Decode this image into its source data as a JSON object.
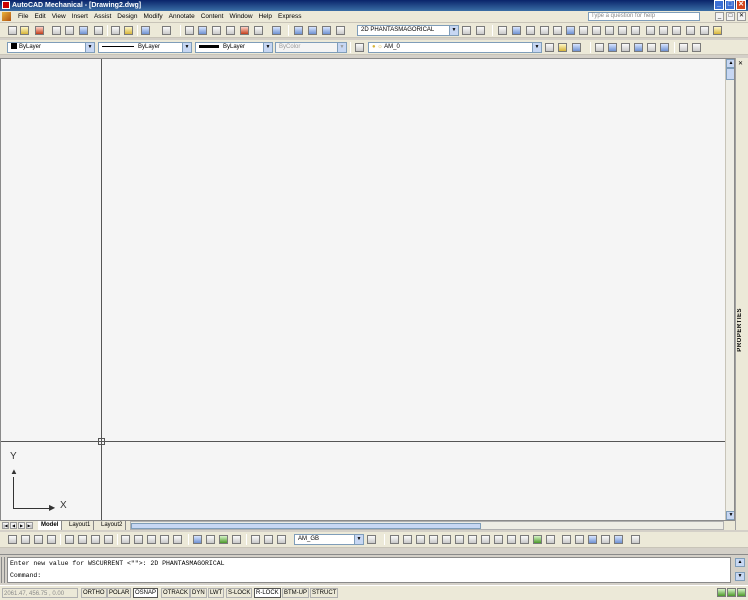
{
  "title": "AutoCAD Mechanical - [Drawing2.dwg]",
  "menu": [
    "File",
    "Edit",
    "View",
    "Insert",
    "Assist",
    "Design",
    "Modify",
    "Annotate",
    "Content",
    "Window",
    "Help",
    "Express"
  ],
  "help_placeholder": "Type a question for help",
  "workspace": "2D PHANTASMAGORICAL",
  "properties": {
    "color": "ByLayer",
    "linetype": "ByLayer",
    "lineweight": "ByLayer",
    "plotstyle": "ByColor"
  },
  "layer": "AM_0",
  "dimstyle": "AM_GB",
  "ucs": {
    "x": "X",
    "y": "Y"
  },
  "layout_tabs": [
    "Model",
    "Layout1",
    "Layout2"
  ],
  "active_tab": "Model",
  "palette_label": "PROPERTIES",
  "command": {
    "history": "Enter new value for WSCURRENT <\"\">: 2D PHANTASMAGORICAL",
    "prompt": "Command:"
  },
  "status": {
    "coords": "2061.47, 456.75 , 0.00",
    "buttons": [
      "ORTHO",
      "POLAR",
      "OSNAP",
      "OTRACK",
      "DYN",
      "LWT",
      "S-LOCK",
      "R-LOCK",
      "BTM-UP",
      "STRUCT"
    ],
    "on": [
      "OSNAP",
      "R-LOCK"
    ]
  },
  "colors": {
    "title": "#0a246a",
    "canvas": "#f5f5f5",
    "chrome": "#ece9d8"
  }
}
